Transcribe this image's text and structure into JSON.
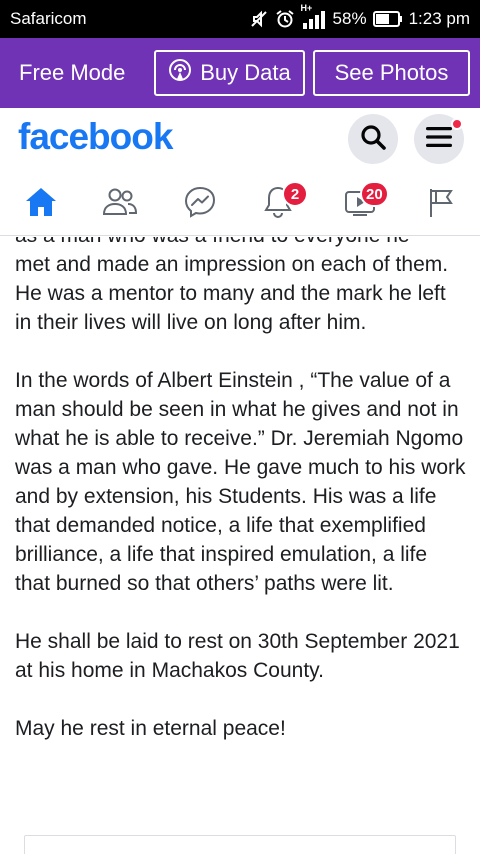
{
  "status_bar": {
    "carrier": "Safaricom",
    "network_type": "H+",
    "battery": "58%",
    "time": "1:23 pm"
  },
  "promo_bar": {
    "free_mode_label": "Free Mode",
    "buy_data_label": "Buy Data",
    "see_photos_label": "See Photos",
    "background_color": "#7133b6"
  },
  "header": {
    "logo_text": "facebook",
    "brand_color": "#1877f2"
  },
  "nav": {
    "notifications_count": "2",
    "watch_count": "20"
  },
  "post": {
    "partial_top_line": "as a man who was a friend to everyone he",
    "paragraphs": [
      "met and made an impression on each of them. He was a mentor to many and the mark he left in their lives will live on long after him.",
      "In the words of Albert Einstein , “The value of a man should be seen in what he gives and not in what he is able to receive.” Dr. Jeremiah Ngomo was a man who gave. He gave much to his work and by extension, his Students. His was a life that demanded notice, a life that exemplified brilliance, a life that inspired emulation, a life that burned so that others’ paths were lit.",
      "He shall be laid to rest on 30th September 2021 at his home in Machakos County.",
      "May he rest in eternal peace!"
    ]
  }
}
